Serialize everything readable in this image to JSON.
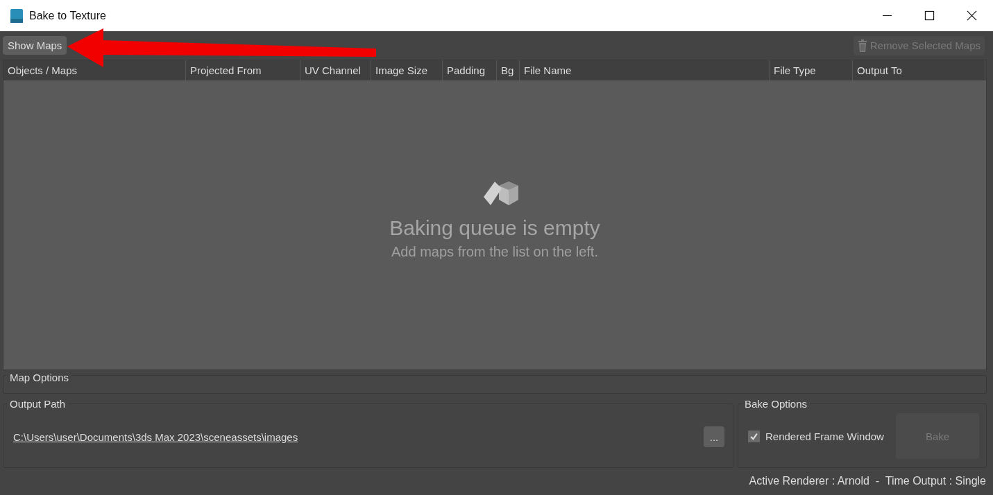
{
  "window": {
    "title": "Bake to Texture"
  },
  "toolbar": {
    "show_maps": {
      "label": "Show Maps",
      "disabled": false
    },
    "remove_selected": {
      "label": "Remove Selected Maps",
      "disabled": true
    }
  },
  "annotation": {
    "kind": "arrow"
  },
  "table": {
    "columns": [
      {
        "label": "Objects / Maps"
      },
      {
        "label": "Projected From"
      },
      {
        "label": "UV Channel"
      },
      {
        "label": "Image Size"
      },
      {
        "label": "Padding"
      },
      {
        "label": "Bg"
      },
      {
        "label": "File Name"
      },
      {
        "label": "File Type"
      },
      {
        "label": "Output To"
      }
    ],
    "empty_title": "Baking queue is empty",
    "empty_hint": "Add maps from the list on the left."
  },
  "map_options": {
    "title": "Map Options"
  },
  "output_path": {
    "title": "Output Path",
    "path": "C:\\Users\\user\\Documents\\3ds Max 2023\\sceneassets\\images",
    "browse": "..."
  },
  "bake_options": {
    "title": "Bake Options",
    "rendered_frame_window": {
      "label": "Rendered Frame Window",
      "checked": true
    },
    "bake": {
      "label": "Bake",
      "disabled": true
    }
  },
  "status_bar": "Active Renderer : Arnold  -  Time Output : Single"
}
